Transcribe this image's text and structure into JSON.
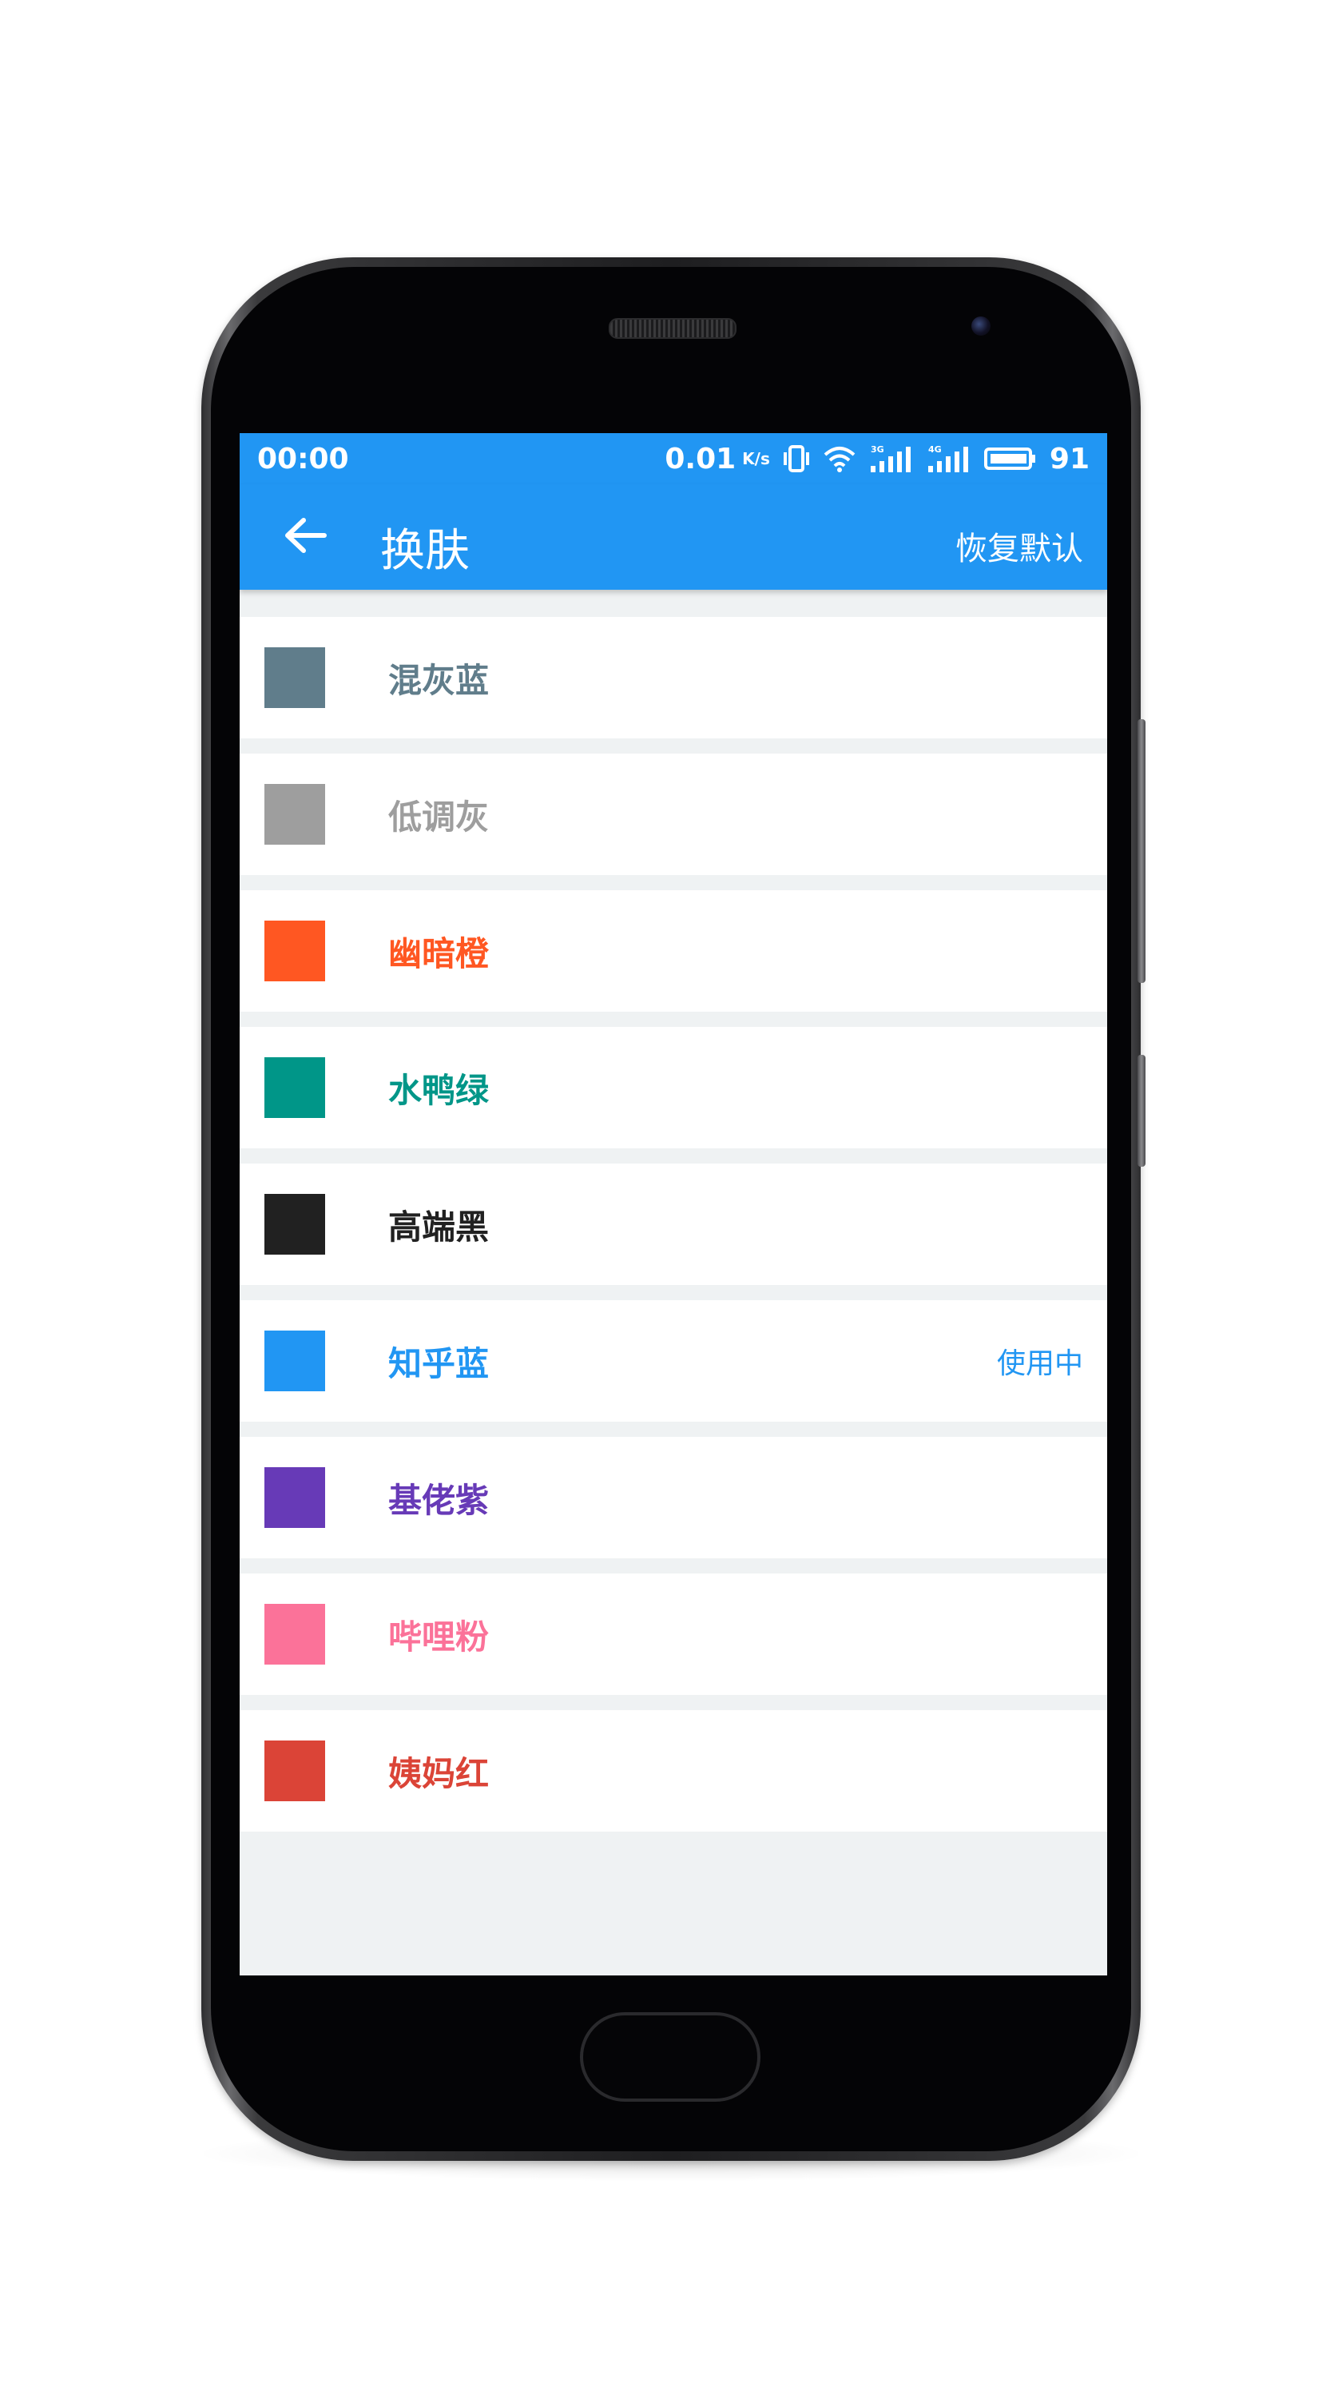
{
  "status_bar": {
    "time": "00:00",
    "net_speed": "0.01",
    "net_unit": "K/s",
    "battery": "91",
    "icons": [
      "vibrate-icon",
      "wifi-icon",
      "signal-3g-icon",
      "signal-4g-icon",
      "battery-icon"
    ]
  },
  "app_bar": {
    "title": "换肤",
    "back_icon": "arrow-left-icon",
    "restore_label": "恢复默认",
    "color": "#2196f3"
  },
  "themes": [
    {
      "label": "混灰蓝",
      "color": "#607d8b",
      "status": ""
    },
    {
      "label": "低调灰",
      "color": "#9e9e9e",
      "status": ""
    },
    {
      "label": "幽暗橙",
      "color": "#ff5722",
      "status": ""
    },
    {
      "label": "水鸭绿",
      "color": "#009688",
      "status": ""
    },
    {
      "label": "高端黑",
      "color": "#212121",
      "status": ""
    },
    {
      "label": "知乎蓝",
      "color": "#2196f3",
      "status": "使用中"
    },
    {
      "label": "基佬紫",
      "color": "#673ab7",
      "status": ""
    },
    {
      "label": "哔哩粉",
      "color": "#fb7299",
      "status": ""
    },
    {
      "label": "姨妈红",
      "color": "#db4437",
      "status": ""
    }
  ]
}
